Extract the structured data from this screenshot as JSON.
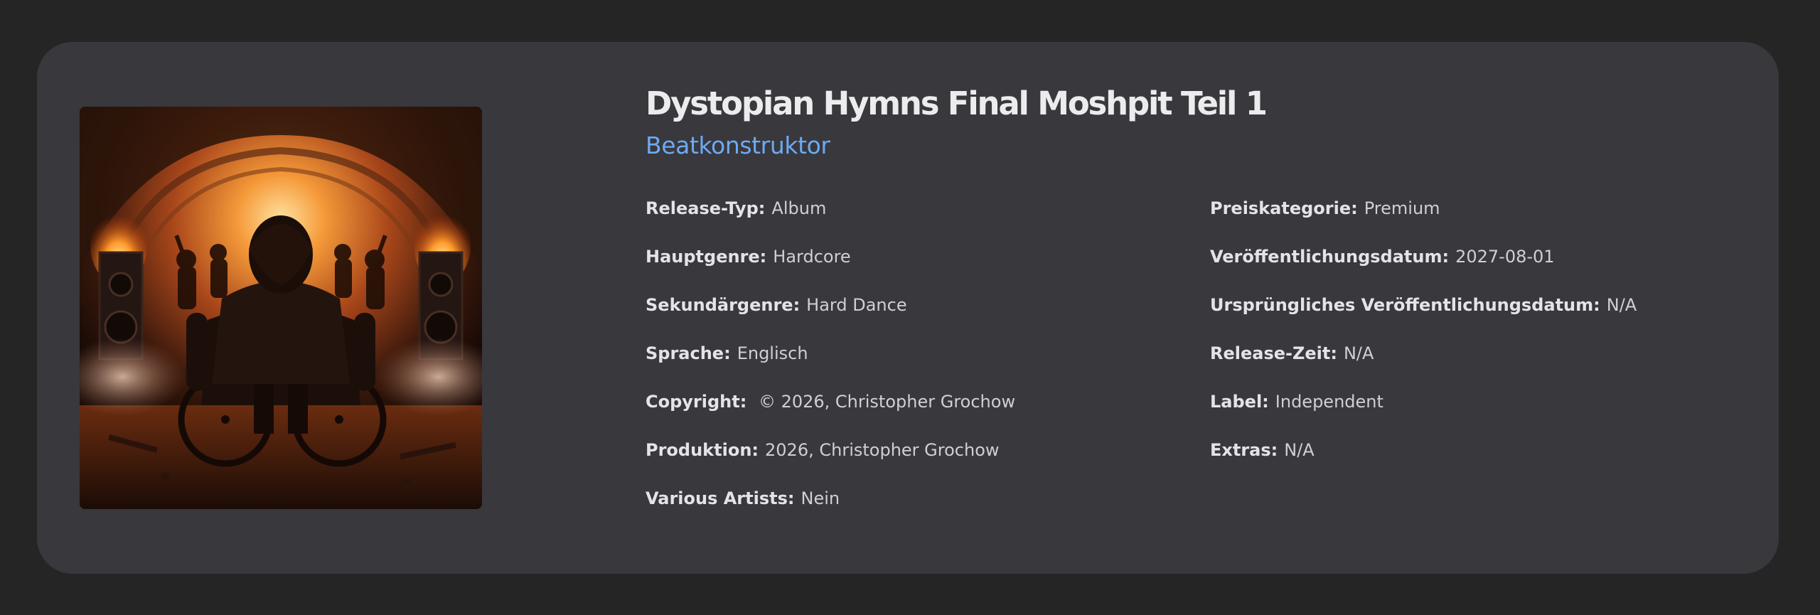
{
  "release": {
    "cover_alt": "Album cover",
    "title": "Dystopian Hymns Final Moshpit Teil 1",
    "artist": "Beatkonstruktor"
  },
  "details_left": [
    {
      "label": "Release-Typ:",
      "value": "Album"
    },
    {
      "label": "Hauptgenre:",
      "value": "Hardcore"
    },
    {
      "label": "Sekundärgenre:",
      "value": "Hard Dance"
    },
    {
      "label": "Sprache:",
      "value": "Englisch"
    },
    {
      "label": "Copyright:",
      "value": " © 2026, Christopher Grochow"
    },
    {
      "label": "Produktion:",
      "value": "2026, Christopher Grochow"
    },
    {
      "label": "Various Artists:",
      "value": "Nein"
    }
  ],
  "details_right": [
    {
      "label": "Preiskategorie:",
      "value": "Premium"
    },
    {
      "label": "Veröffentlichungsdatum:",
      "value": "2027-08-01"
    },
    {
      "label": "Ursprüngliches Veröffentlichungsdatum:",
      "value": "N/A"
    },
    {
      "label": "Release-Zeit:",
      "value": "N/A"
    },
    {
      "label": "Label:",
      "value": "Independent"
    },
    {
      "label": "Extras:",
      "value": "N/A"
    }
  ],
  "colors": {
    "page_background": "#252525",
    "card_background": "#38383d",
    "title": "#ececee",
    "artist_accent": "#6daaf2"
  }
}
